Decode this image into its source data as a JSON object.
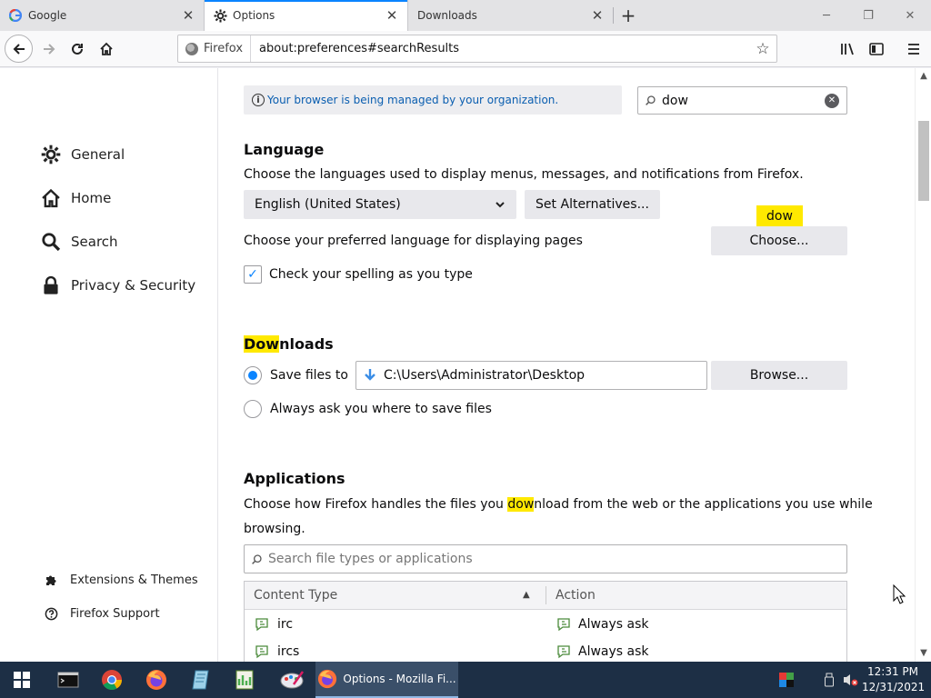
{
  "browser": {
    "tabs": [
      {
        "label": "Google",
        "icon": "google-icon"
      },
      {
        "label": "Options",
        "icon": "gear-icon"
      },
      {
        "label": "Downloads",
        "icon": "none"
      }
    ],
    "url_identity": "Firefox",
    "url": "about:preferences#searchResults"
  },
  "sidebar": {
    "categories": [
      {
        "label": "General",
        "icon": "gear-icon"
      },
      {
        "label": "Home",
        "icon": "home-icon"
      },
      {
        "label": "Search",
        "icon": "search-icon"
      },
      {
        "label": "Privacy & Security",
        "icon": "lock-icon"
      }
    ],
    "extensions": "Extensions & Themes",
    "support": "Firefox Support"
  },
  "main": {
    "policy_notice": "Your browser is being managed by your organization.",
    "search_value": "dow",
    "language": {
      "heading": "Language",
      "description": "Choose the languages used to display menus, messages, and notifications from Firefox.",
      "selected_language": "English (United States)",
      "set_alternatives": "Set Alternatives...",
      "pages_label": "Choose your preferred language for displaying pages",
      "choose_button": "Choose...",
      "highlight_badge": "dow",
      "spellcheck_label": "Check your spelling as you type",
      "spellcheck_checked": true
    },
    "downloads": {
      "heading_hl": "Dow",
      "heading_rest": "nloads",
      "save_files_label": "Save files to",
      "save_path": "C:\\Users\\Administrator\\Desktop",
      "browse_button": "Browse...",
      "always_ask_label": "Always ask you where to save files",
      "selected": "save_files"
    },
    "applications": {
      "heading": "Applications",
      "desc_part1": "Choose how Firefox handles the files you ",
      "desc_hl": "dow",
      "desc_part2": "nload from the web or the applications you use while",
      "desc_line2": "browsing.",
      "search_placeholder": "Search file types or applications",
      "columns": [
        "Content Type",
        "Action"
      ],
      "rows": [
        {
          "type": "irc",
          "action": "Always ask"
        },
        {
          "type": "ircs",
          "action": "Always ask"
        }
      ]
    }
  },
  "taskbar": {
    "active_window": "Options - Mozilla Fi...",
    "time": "12:31 PM",
    "date": "12/31/2021"
  },
  "colors": {
    "accent": "#0a84ff",
    "highlight": "#ffe900",
    "taskbar": "#1d2f45"
  }
}
